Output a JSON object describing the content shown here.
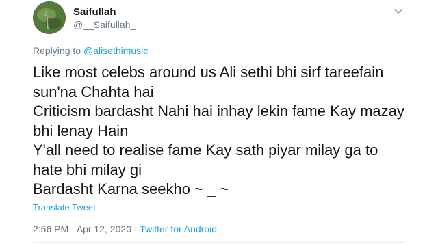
{
  "author": {
    "display_name": "Saifullah",
    "handle": "@__Saifullah_"
  },
  "reply": {
    "prefix": "Replying to ",
    "mention": "@alisethimusic"
  },
  "tweet": {
    "lines": [
      "Like most celebs around us Ali sethi bhi sirf tareefain",
      "sun'na Chahta hai",
      "Criticism bardasht Nahi hai inhay lekin fame Kay mazay",
      "bhi lenay Hain",
      "Y'all need to realise fame Kay sath piyar milay ga to",
      "hate bhi milay gi",
      "Bardasht Karna seekho ~ _ ~"
    ]
  },
  "translate_label": "Translate Tweet",
  "meta": {
    "time": "2:56 PM",
    "separator": " · ",
    "date": "Apr 12, 2020",
    "source": "Twitter for Android"
  },
  "icons": {
    "avatar": "profile-photo",
    "caret": "chevron-down-icon"
  },
  "colors": {
    "link": "#1da1f2",
    "secondary_text": "#657786",
    "primary_text": "#14171a"
  }
}
